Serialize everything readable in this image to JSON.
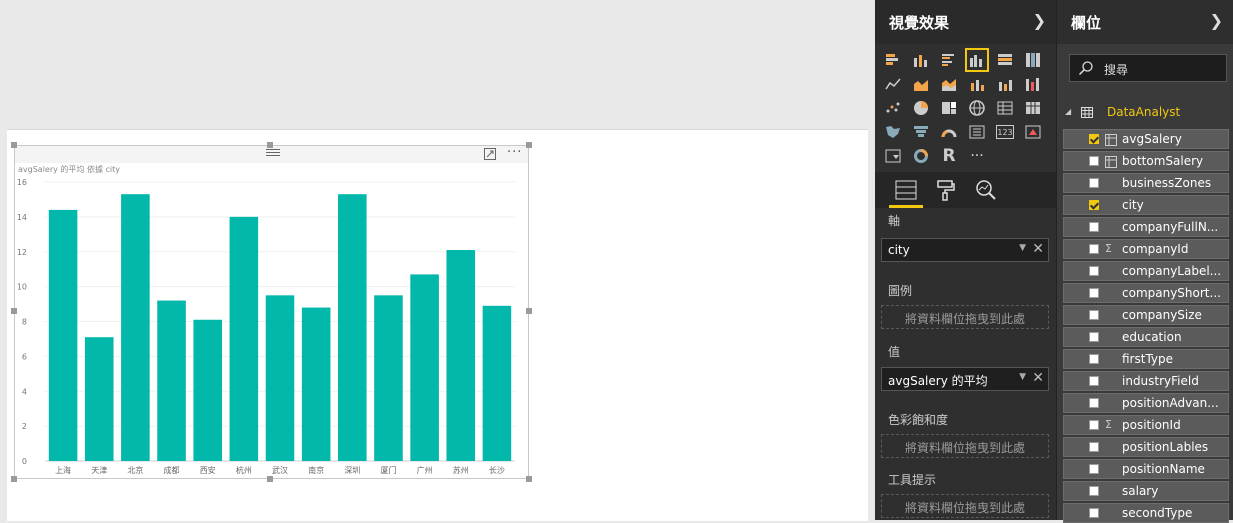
{
  "visualizations_pane": {
    "title": "視覺效果",
    "wells": [
      {
        "label": "軸",
        "value": "city"
      },
      {
        "label": "圖例",
        "placeholder": "將資料欄位拖曳到此處"
      },
      {
        "label": "值",
        "value": "avgSalery 的平均"
      },
      {
        "label": "色彩飽和度",
        "placeholder": "將資料欄位拖曳到此處"
      },
      {
        "label": "工具提示",
        "placeholder": "將資料欄位拖曳到此處"
      }
    ]
  },
  "fields_pane": {
    "title": "欄位",
    "search_placeholder": "搜尋",
    "table_name": "DataAnalyst",
    "fields": [
      {
        "name": "avgSalery",
        "checked": true,
        "type": "calc"
      },
      {
        "name": "bottomSalery",
        "checked": false,
        "type": "calc"
      },
      {
        "name": "businessZones",
        "checked": false,
        "type": ""
      },
      {
        "name": "city",
        "checked": true,
        "type": ""
      },
      {
        "name": "companyFullN...",
        "checked": false,
        "type": ""
      },
      {
        "name": "companyId",
        "checked": false,
        "type": "sigma"
      },
      {
        "name": "companyLabel...",
        "checked": false,
        "type": ""
      },
      {
        "name": "companyShort...",
        "checked": false,
        "type": ""
      },
      {
        "name": "companySize",
        "checked": false,
        "type": ""
      },
      {
        "name": "education",
        "checked": false,
        "type": ""
      },
      {
        "name": "firstType",
        "checked": false,
        "type": ""
      },
      {
        "name": "industryField",
        "checked": false,
        "type": ""
      },
      {
        "name": "positionAdvan...",
        "checked": false,
        "type": ""
      },
      {
        "name": "positionId",
        "checked": false,
        "type": "sigma"
      },
      {
        "name": "positionLables",
        "checked": false,
        "type": ""
      },
      {
        "name": "positionName",
        "checked": false,
        "type": ""
      },
      {
        "name": "salary",
        "checked": false,
        "type": ""
      },
      {
        "name": "secondType",
        "checked": false,
        "type": ""
      }
    ]
  },
  "chart_data": {
    "type": "bar",
    "title": "avgSalery 的平均 依據 city",
    "categories": [
      "上海",
      "天津",
      "北京",
      "成都",
      "西安",
      "杭州",
      "武汉",
      "南京",
      "深圳",
      "厦门",
      "广州",
      "苏州",
      "长沙"
    ],
    "values": [
      14.4,
      7.1,
      15.3,
      9.2,
      8.1,
      14.0,
      9.5,
      8.8,
      15.3,
      9.5,
      10.7,
      12.1,
      8.9
    ],
    "ylim": [
      0,
      16
    ],
    "yticks": [
      0,
      2,
      4,
      6,
      8,
      10,
      12,
      14,
      16
    ],
    "bar_color": "#01b8aa",
    "grid": true
  },
  "colors": {
    "accent": "#f2c811",
    "bar": "#01b8aa"
  }
}
